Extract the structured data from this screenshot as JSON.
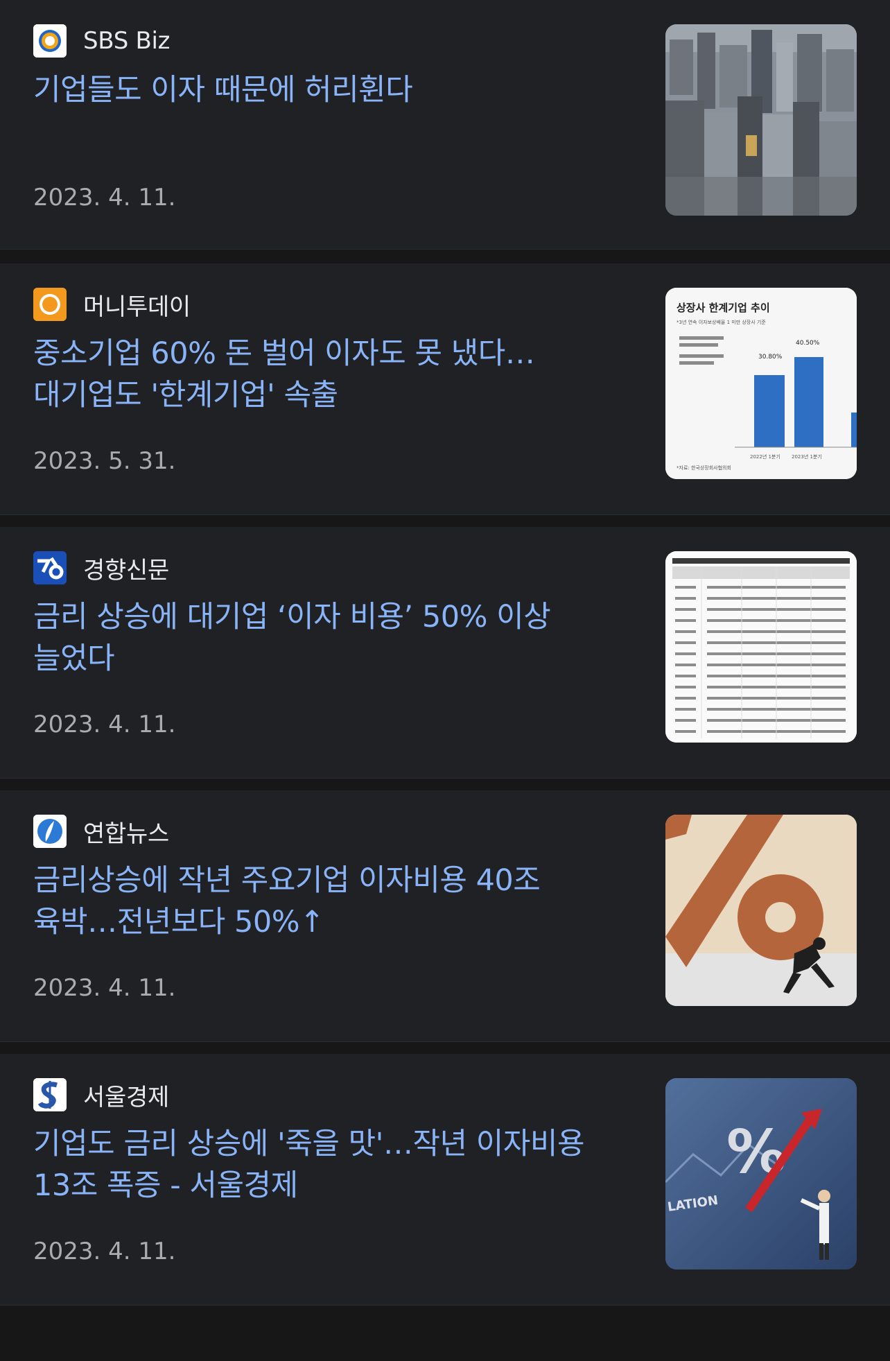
{
  "articles": [
    {
      "source": "SBS Biz",
      "headline": "기업들도 이자 때문에 허리휜다",
      "date": "2023. 4. 11."
    },
    {
      "source": "머니투데이",
      "headline": "중소기업 60% 돈 벌어 이자도 못 냈다…대기업도 '한계기업' 속출",
      "date": "2023. 5. 31."
    },
    {
      "source": "경향신문",
      "headline": "금리 상승에 대기업 ‘이자 비용’ 50% 이상 늘었다",
      "date": "2023. 4. 11."
    },
    {
      "source": "연합뉴스",
      "headline": "금리상승에 작년 주요기업 이자비용 40조 육박…전년보다 50%↑",
      "date": "2023. 4. 11."
    },
    {
      "source": "서울경제",
      "headline": "기업도 금리 상승에 '죽을 맛'…작년 이자비용 13조 폭증 - 서울경제",
      "date": "2023. 4. 11."
    }
  ],
  "thumbnail_text": {
    "chart_title": "상장사 한계기업 추이",
    "chart_subtitle": "*3년 연속 이자보상배율 1 미만 상장사 기준",
    "chart_label_1": "30.80%",
    "chart_label_2": "40.50%",
    "chart_x1": "2022년 1분기",
    "chart_x2": "2023년 1분기",
    "chart_source": "*자료: 한국상장회사협의회",
    "inflation_text": "LATION"
  },
  "colors": {
    "page_background": "#171717",
    "card_background": "#202124",
    "headline": "#8ab4f8",
    "source_text": "#e8eaed",
    "date_text": "#a9acb1"
  },
  "icons": {
    "sbs_biz": "sbs-biz-logo-icon",
    "moneytoday": "moneytoday-logo-icon",
    "khan": "khan-logo-icon",
    "yonhap": "yonhap-logo-icon",
    "sedaily": "sedaily-logo-icon"
  }
}
